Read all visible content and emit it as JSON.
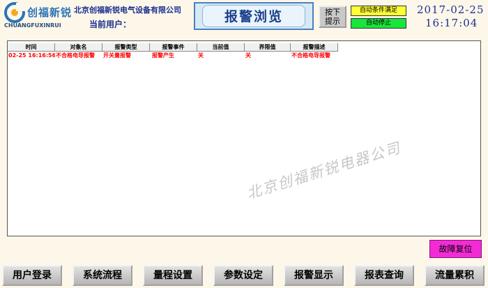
{
  "header": {
    "logo_cn": "创福新锐",
    "logo_en": "CHUANGFUXINRUI",
    "company": "北京创福新锐电气设备有限公司",
    "user_label": "当前用户：",
    "title": "报警浏览",
    "press_button": [
      "按下",
      "提示"
    ],
    "status_auto": "自动条件满足",
    "status_stop": "自动停止",
    "date": "2017-02-25",
    "time": "16:17:04"
  },
  "table": {
    "columns": [
      "时间",
      "对象名",
      "报警类型",
      "报警事件",
      "当前值",
      "界限值",
      "报警描述"
    ],
    "rows": [
      [
        "02-25 16:16:56",
        "不合格电导报警",
        "开关量报警",
        "报警产生",
        "关",
        "关",
        "不合格电导报警"
      ]
    ]
  },
  "watermark": "北京创福新锐电器公司",
  "reset_button": "故障复位",
  "nav": [
    "用户登录",
    "系统流程",
    "量程设置",
    "参数设定",
    "报警显示",
    "报表查询",
    "流量累积"
  ],
  "colors": {
    "background": "#fdf7ea",
    "header_text": "#1a2f8f",
    "alarm_text": "#ff0000",
    "status_auto": "#ffff33",
    "status_stop": "#19e53a",
    "reset_button": "#f22bd5"
  }
}
